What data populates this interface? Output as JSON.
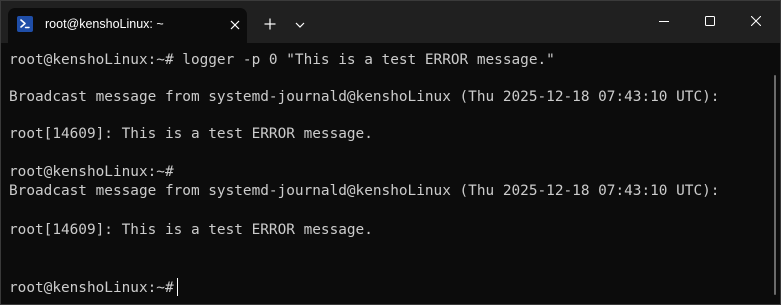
{
  "tab": {
    "title": "root@kenshoLinux: ~",
    "icon": "terminal-icon"
  },
  "titlebar": {
    "new_tab_icon": "plus-icon",
    "dropdown_icon": "chevron-down-icon",
    "minimize_icon": "minimize-icon",
    "maximize_icon": "maximize-icon",
    "close_icon": "close-icon"
  },
  "terminal": {
    "lines": [
      "root@kenshoLinux:~# logger -p 0 \"This is a test ERROR message.\"",
      "Broadcast message from systemd-journald@kenshoLinux (Thu 2025-12-18 07:43:10 UTC):",
      "root[14609]: This is a test ERROR message.",
      "root@kenshoLinux:~#",
      "Broadcast message from systemd-journald@kenshoLinux (Thu 2025-12-18 07:43:10 UTC):",
      "root[14609]: This is a test ERROR message.",
      "root@kenshoLinux:~#"
    ]
  },
  "colors": {
    "background": "#0c0c0c",
    "titlebar": "#202020",
    "text": "#cccccc",
    "icon_accent": "#1f4ea8"
  }
}
